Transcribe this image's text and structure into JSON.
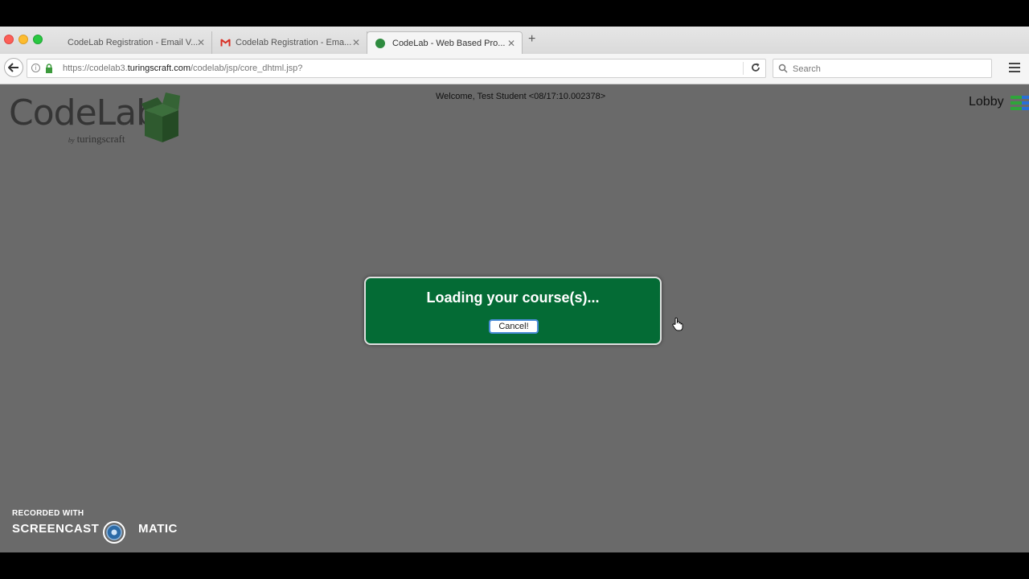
{
  "browser": {
    "tabs": [
      {
        "label": "CodeLab Registration - Email V...",
        "active": false,
        "icon": "none"
      },
      {
        "label": "Codelab Registration - Ema...",
        "active": false,
        "icon": "gmail-icon"
      },
      {
        "label": "CodeLab - Web Based Pro...",
        "active": true,
        "icon": "codelab-favicon"
      }
    ],
    "new_tab_label": "+",
    "close_glyph": "✕",
    "url": {
      "prefix": "https://codelab3.",
      "host": "turingscraft.com",
      "path": "/codelab/jsp/core_dhtml.jsp?"
    },
    "search_placeholder": "Search"
  },
  "page": {
    "background": "#6a6a6a",
    "logo": {
      "name": "CodeLab",
      "by": "by",
      "company": "turingscraft"
    },
    "welcome": "Welcome, Test Student <08/17:10.002378>",
    "lobby_label": "Lobby",
    "dialog": {
      "title": "Loading your course(s)...",
      "cancel_label": "Cancel!",
      "background": "#046b35"
    }
  },
  "watermark": {
    "top": "RECORDED WITH",
    "left_word": "SCREENCAST",
    "right_word": "MATIC"
  }
}
